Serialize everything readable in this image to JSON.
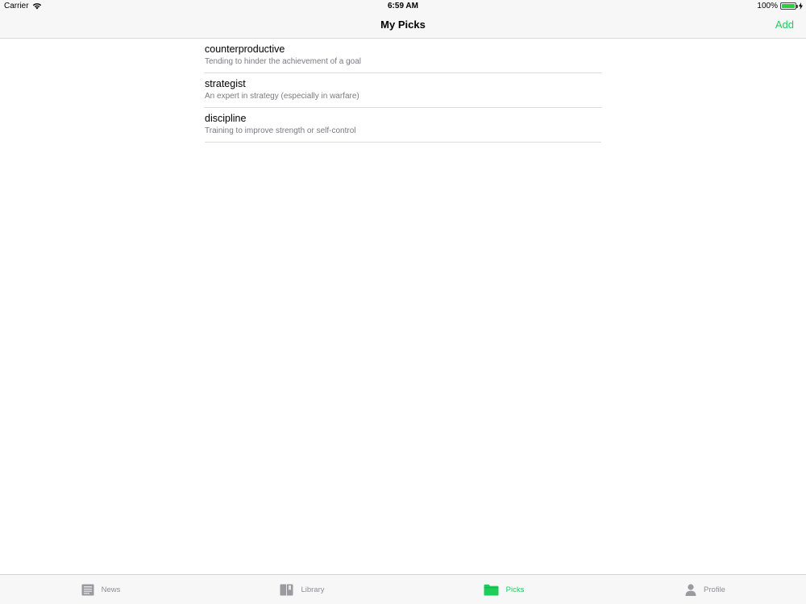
{
  "status_bar": {
    "carrier": "Carrier",
    "time": "6:59 AM",
    "battery": "100%",
    "battery_level": 1.0
  },
  "nav": {
    "title": "My Picks",
    "add_label": "Add"
  },
  "picks": [
    {
      "word": "counterproductive",
      "definition": "Tending to hinder the achievement of a goal"
    },
    {
      "word": "strategist",
      "definition": "An expert in strategy (especially in warfare)"
    },
    {
      "word": "discipline",
      "definition": "Training to improve strength or self-control"
    }
  ],
  "tabs": [
    {
      "label": "News",
      "icon": "newspaper-icon",
      "active": false
    },
    {
      "label": "Library",
      "icon": "book-icon",
      "active": false
    },
    {
      "label": "Picks",
      "icon": "folder-icon",
      "active": true
    },
    {
      "label": "Profile",
      "icon": "person-icon",
      "active": false
    }
  ],
  "colors": {
    "accent": "#1fce5a",
    "inactive": "#8e8e93"
  }
}
